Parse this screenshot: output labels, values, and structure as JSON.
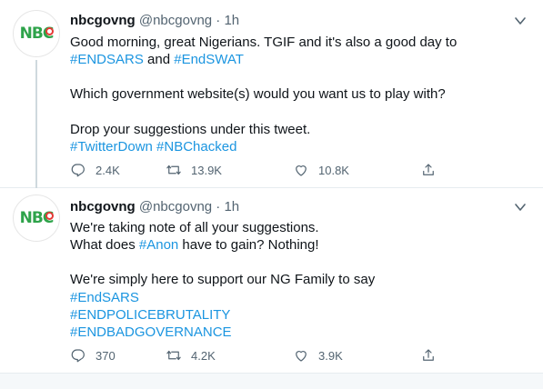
{
  "tweets": [
    {
      "name": "nbcgovng",
      "handle": "@nbcgovng",
      "separator": "·",
      "time": "1h",
      "avatar_text": "NBC",
      "lines": [
        [
          "Good morning, great Nigerians. TGIF and it's also a good day to"
        ],
        [
          "#ENDSARS",
          " and ",
          "#EndSWAT"
        ],
        [],
        [
          "Which government website(s) would you want us to play with?"
        ],
        [],
        [
          "Drop your suggestions under this tweet."
        ],
        [
          "#TwitterDown",
          " ",
          "#NBChacked"
        ]
      ],
      "replies": "2.4K",
      "retweets": "13.9K",
      "likes": "10.8K"
    },
    {
      "name": "nbcgovng",
      "handle": "@nbcgovng",
      "separator": "·",
      "time": "1h",
      "avatar_text": "NBC",
      "lines": [
        [
          "We're taking note of all your suggestions."
        ],
        [
          "What does ",
          "#Anon",
          " have to gain? Nothing!"
        ],
        [],
        [
          "We're simply here to support our NG Family to say"
        ],
        [
          "#EndSARS"
        ],
        [
          "#ENDPOLICEBRUTALITY"
        ],
        [
          "#ENDBADGOVERNANCE"
        ]
      ],
      "replies": "370",
      "retweets": "4.2K",
      "likes": "3.9K"
    }
  ],
  "colors": {
    "hashtag": "#1b95e0",
    "secondary": "#536471",
    "logo_green": "#2ea34a",
    "logo_red": "#e53935"
  },
  "icons": [
    "reply-icon",
    "retweet-icon",
    "like-icon",
    "share-icon",
    "caret-down-icon"
  ]
}
